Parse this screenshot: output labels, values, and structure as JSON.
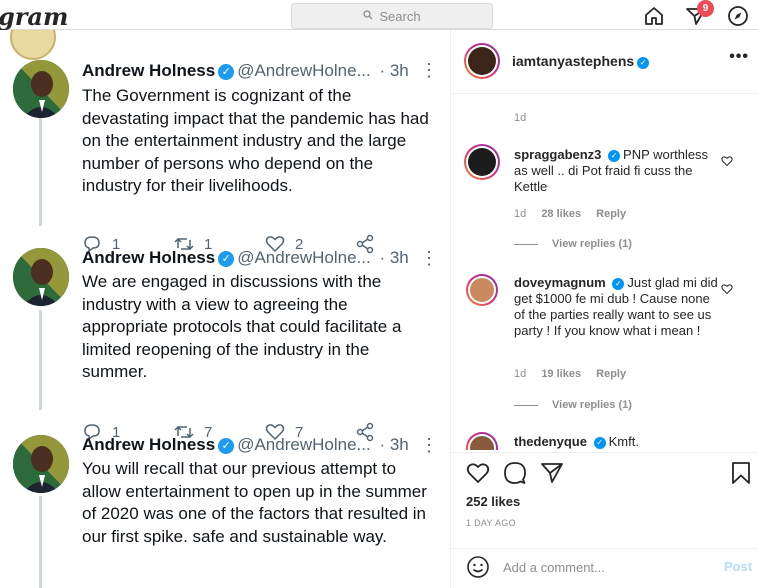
{
  "topbar": {
    "logo": "gram",
    "search_placeholder": "Search",
    "notification_count": "9"
  },
  "tweets": [
    {
      "name": "Andrew Holness",
      "handle": "@AndrewHolne...",
      "time": "· 3h",
      "text": "The Government is cognizant of the devastating impact that the pandemic has had on the entertainment industry and the large number of persons who depend on the industry for their livelihoods.",
      "replies": "1",
      "retweets": "1",
      "likes": "2"
    },
    {
      "name": "Andrew Holness",
      "handle": "@AndrewHolne...",
      "time": "· 3h",
      "text": "We are engaged in discussions with the industry with a view to agreeing the appropriate protocols that could facilitate a limited reopening of the industry in the summer.",
      "replies": "1",
      "retweets": "7",
      "likes": "7"
    },
    {
      "name": "Andrew Holness",
      "handle": "@AndrewHolne...",
      "time": "· 3h",
      "text": "You will recall that our previous attempt to allow entertainment to open up in the summer of 2020 was one of the factors that resulted in our first spike. safe and sustainable way."
    }
  ],
  "post": {
    "author": "iamtanyastephens",
    "caption_time": "1d",
    "likes": "252 likes",
    "time_ago": "1 DAY AGO",
    "comment_placeholder": "Add a comment...",
    "post_label": "Post"
  },
  "comments": [
    {
      "user": "spraggabenz3",
      "text": "PNP worthless as well .. di Pot fraid fi cuss the Kettle",
      "time": "1d",
      "likes": "28 likes",
      "reply": "Reply",
      "view_replies": "View replies (1)"
    },
    {
      "user": "doveymagnum",
      "text": "Just glad mi did get $1000 fe mi dub ! Cause none of the parties really want to see us party ! If you know what i mean !",
      "time": "1d",
      "likes": "19 likes",
      "reply": "Reply",
      "view_replies": "View replies (1)"
    },
    {
      "user": "thedenyque",
      "text": "Kmft."
    }
  ]
}
